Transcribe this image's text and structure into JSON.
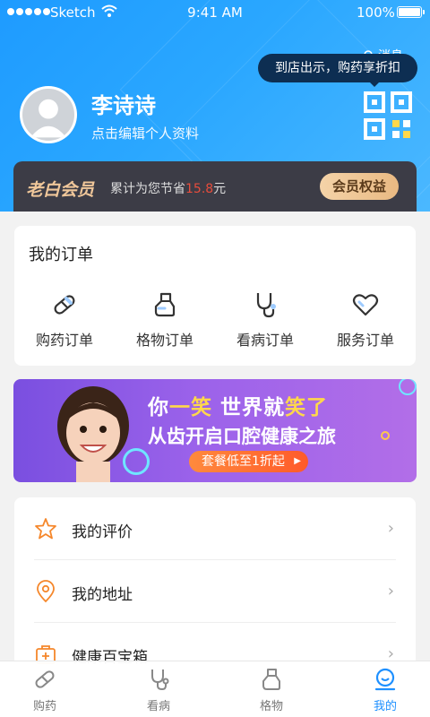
{
  "status_bar": {
    "carrier": "Sketch",
    "time": "9:41 AM",
    "battery": "100%"
  },
  "header": {
    "message_label": "消息",
    "tooltip": "到店出示，购药享折扣",
    "user_name": "李诗诗",
    "user_subtitle": "点击编辑个人资料"
  },
  "vip": {
    "title": "老白会员",
    "savings_prefix": "累计为您节省",
    "savings_amount": "15.8",
    "savings_unit": "元",
    "benefits_button": "会员权益"
  },
  "orders": {
    "title": "我的订单",
    "items": [
      {
        "label": "购药订单",
        "icon": "pill-icon"
      },
      {
        "label": "格物订单",
        "icon": "goods-icon"
      },
      {
        "label": "看病订单",
        "icon": "stethoscope-icon"
      },
      {
        "label": "服务订单",
        "icon": "heart-icon"
      }
    ]
  },
  "banner": {
    "line1_a": "你",
    "line1_b": "一笑",
    "line1_c": " 世界就",
    "line1_d": "笑了",
    "line2": "从齿开启口腔健康之旅",
    "cta": "套餐低至1折起"
  },
  "menu": [
    {
      "label": "我的评价",
      "icon": "star-icon"
    },
    {
      "label": "我的地址",
      "icon": "location-icon"
    },
    {
      "label": "健康百宝箱",
      "icon": "medkit-icon"
    }
  ],
  "tabbar": {
    "items": [
      {
        "label": "购药",
        "icon": "pill-icon"
      },
      {
        "label": "看病",
        "icon": "stethoscope-icon"
      },
      {
        "label": "格物",
        "icon": "goods-icon"
      },
      {
        "label": "我的",
        "icon": "user-icon"
      }
    ],
    "active_index": 3
  },
  "colors": {
    "primary": "#1e90ff",
    "vip_gold": "#f0c79a",
    "accent_orange": "#ff6a2a"
  }
}
